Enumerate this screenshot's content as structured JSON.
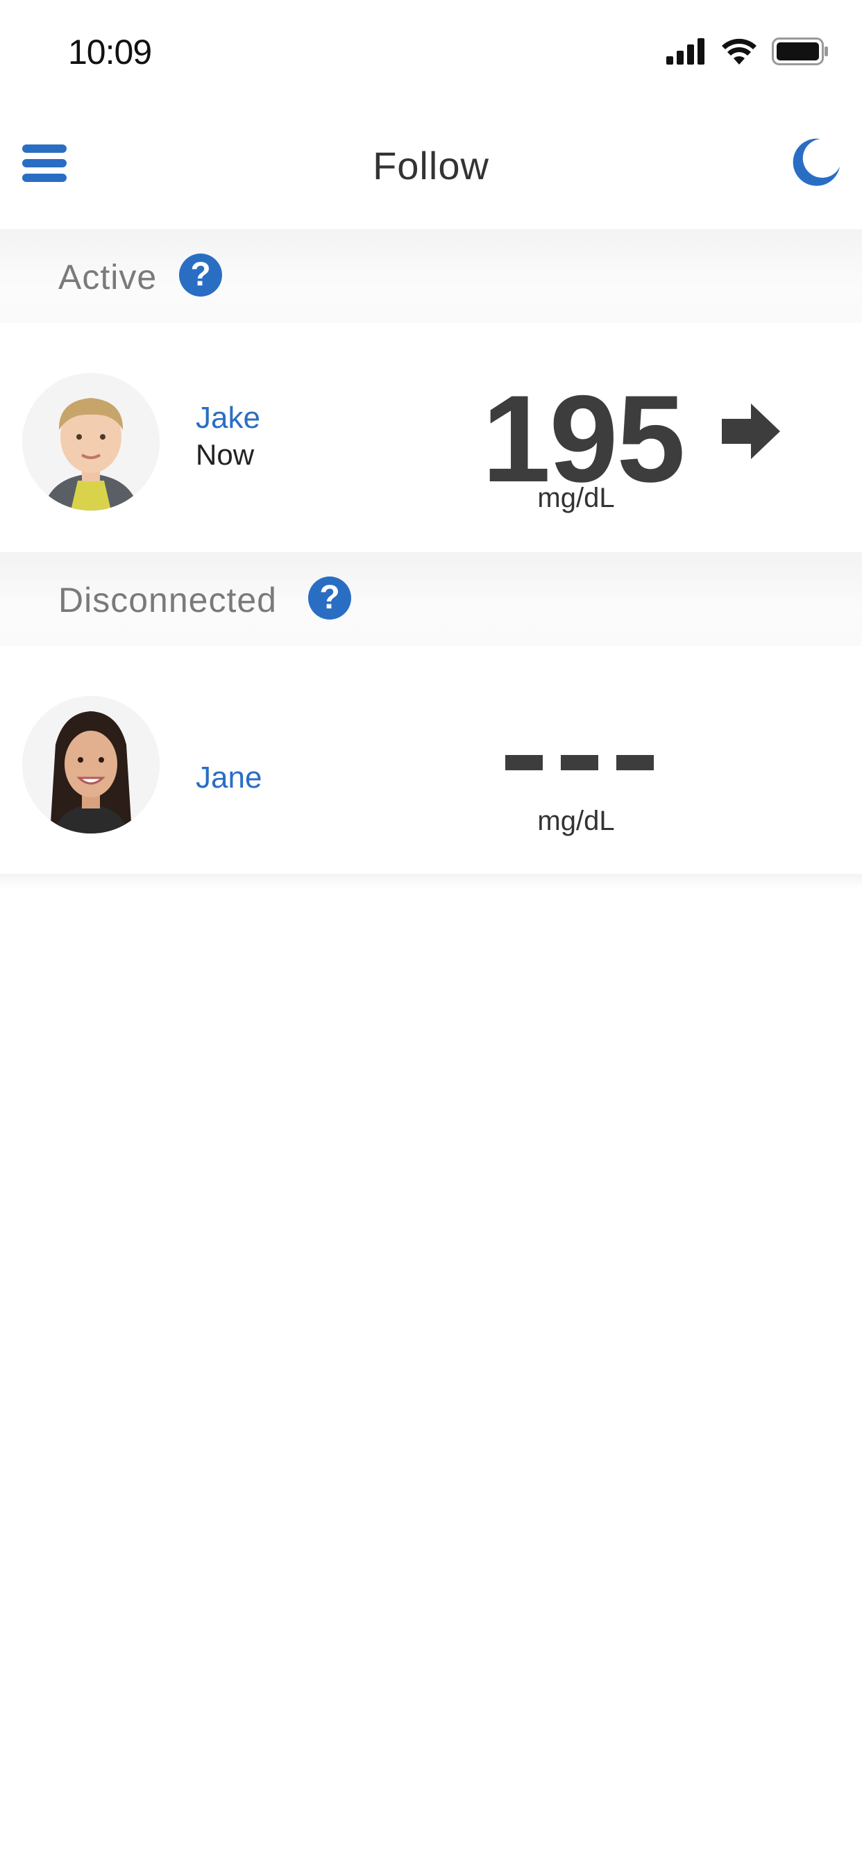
{
  "status_bar": {
    "time": "10:09"
  },
  "nav": {
    "title": "Follow",
    "menu_icon": "hamburger-menu-icon",
    "theme_icon": "moon-icon"
  },
  "sections": {
    "active": {
      "label": "Active",
      "help_glyph": "?"
    },
    "disconnected": {
      "label": "Disconnected",
      "help_glyph": "?"
    }
  },
  "followers": {
    "jake": {
      "name": "Jake",
      "status": "Now",
      "glucose": "195",
      "unit": "mg/dL",
      "trend": "right-arrow-icon"
    },
    "jane": {
      "name": "Jane",
      "unit": "mg/dL"
    }
  },
  "colors": {
    "accent": "#2a6ec4",
    "value_text": "#3d3d3d",
    "section_label": "#7a7a7a"
  }
}
